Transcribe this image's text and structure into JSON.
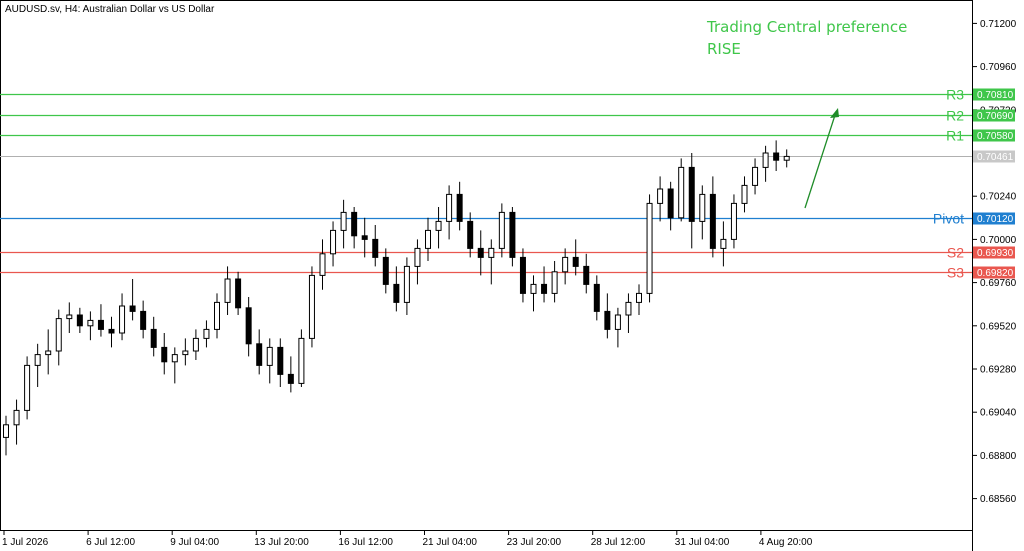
{
  "symbol_title": "AUDUSD.sv, H4:  Australian Dollar vs US Dollar",
  "preference": {
    "line1": "Trading Central preference",
    "line2": "RISE"
  },
  "colors": {
    "resistance": "#3fc64a",
    "support": "#e9574f",
    "pivot": "#1f7fd0",
    "arrow": "#1e8c28",
    "current": "#b0b0b0",
    "candle": "#000000"
  },
  "price_axis": {
    "ticks": [
      "0.71200",
      "0.70960",
      "0.70720",
      "0.70240",
      "0.70000",
      "0.69760",
      "0.69520",
      "0.69280",
      "0.69040",
      "0.68800",
      "0.68560"
    ]
  },
  "time_axis": {
    "ticks": [
      "1 Jul 2026",
      "6 Jul 12:00",
      "9 Jul 04:00",
      "13 Jul 20:00",
      "16 Jul 12:00",
      "21 Jul 04:00",
      "23 Jul 20:00",
      "28 Jul 12:00",
      "31 Jul 04:00",
      "4 Aug 20:00"
    ]
  },
  "levels": [
    {
      "name": "R3",
      "value": 0.7081,
      "label": "0.70810",
      "kind": "resistance"
    },
    {
      "name": "R2",
      "value": 0.7069,
      "label": "0.70690",
      "kind": "resistance"
    },
    {
      "name": "R1",
      "value": 0.7058,
      "label": "0.70580",
      "kind": "resistance"
    },
    {
      "name": "Pivot",
      "value": 0.7012,
      "label": "0.70120",
      "kind": "pivot"
    },
    {
      "name": "S2",
      "value": 0.6993,
      "label": "0.69930",
      "kind": "support"
    },
    {
      "name": "S3",
      "value": 0.6982,
      "label": "0.69820",
      "kind": "support"
    }
  ],
  "current_price": {
    "value": 0.70461,
    "label": "0.70461"
  },
  "chart_data": {
    "type": "candlestick",
    "ohlc": [
      [
        0.689,
        0.6902,
        0.688,
        0.6897
      ],
      [
        0.6897,
        0.6911,
        0.6886,
        0.6905
      ],
      [
        0.6905,
        0.6935,
        0.69,
        0.693
      ],
      [
        0.693,
        0.6942,
        0.6918,
        0.6936
      ],
      [
        0.6936,
        0.695,
        0.6925,
        0.6938
      ],
      [
        0.6938,
        0.6961,
        0.693,
        0.6956
      ],
      [
        0.6956,
        0.6965,
        0.6948,
        0.6958
      ],
      [
        0.6958,
        0.6962,
        0.6948,
        0.6952
      ],
      [
        0.6952,
        0.696,
        0.6944,
        0.6955
      ],
      [
        0.6955,
        0.6964,
        0.6946,
        0.695
      ],
      [
        0.695,
        0.6957,
        0.694,
        0.6948
      ],
      [
        0.6948,
        0.697,
        0.6944,
        0.6963
      ],
      [
        0.6963,
        0.6978,
        0.6955,
        0.696
      ],
      [
        0.696,
        0.6966,
        0.6945,
        0.695
      ],
      [
        0.695,
        0.6957,
        0.6935,
        0.694
      ],
      [
        0.694,
        0.6948,
        0.6925,
        0.6932
      ],
      [
        0.6932,
        0.694,
        0.692,
        0.6936
      ],
      [
        0.6936,
        0.6945,
        0.693,
        0.6938
      ],
      [
        0.6938,
        0.695,
        0.6933,
        0.6945
      ],
      [
        0.6945,
        0.6955,
        0.694,
        0.695
      ],
      [
        0.695,
        0.697,
        0.6945,
        0.6965
      ],
      [
        0.6965,
        0.6985,
        0.6958,
        0.6978
      ],
      [
        0.6978,
        0.6982,
        0.6958,
        0.6962
      ],
      [
        0.6962,
        0.6968,
        0.6935,
        0.6942
      ],
      [
        0.6942,
        0.695,
        0.6925,
        0.693
      ],
      [
        0.693,
        0.6945,
        0.692,
        0.694
      ],
      [
        0.694,
        0.6945,
        0.6918,
        0.6925
      ],
      [
        0.6925,
        0.6935,
        0.6915,
        0.692
      ],
      [
        0.692,
        0.695,
        0.6918,
        0.6945
      ],
      [
        0.6945,
        0.6985,
        0.694,
        0.698
      ],
      [
        0.698,
        0.7,
        0.6972,
        0.6992
      ],
      [
        0.6992,
        0.701,
        0.6985,
        0.7005
      ],
      [
        0.7005,
        0.7022,
        0.6995,
        0.7015
      ],
      [
        0.7015,
        0.7018,
        0.6995,
        0.7002
      ],
      [
        0.7002,
        0.7012,
        0.699,
        0.7
      ],
      [
        0.7,
        0.7008,
        0.6985,
        0.699
      ],
      [
        0.699,
        0.6995,
        0.697,
        0.6975
      ],
      [
        0.6975,
        0.6985,
        0.696,
        0.6965
      ],
      [
        0.6965,
        0.699,
        0.6958,
        0.6985
      ],
      [
        0.6985,
        0.7,
        0.6975,
        0.6995
      ],
      [
        0.6995,
        0.7012,
        0.6988,
        0.7005
      ],
      [
        0.7005,
        0.7018,
        0.6995,
        0.701
      ],
      [
        0.701,
        0.703,
        0.7,
        0.7025
      ],
      [
        0.7025,
        0.7032,
        0.7005,
        0.701
      ],
      [
        0.701,
        0.7015,
        0.699,
        0.6995
      ],
      [
        0.6995,
        0.7005,
        0.698,
        0.699
      ],
      [
        0.699,
        0.7,
        0.6975,
        0.6995
      ],
      [
        0.6995,
        0.702,
        0.699,
        0.7015
      ],
      [
        0.7015,
        0.7018,
        0.6985,
        0.699
      ],
      [
        0.699,
        0.6995,
        0.6965,
        0.697
      ],
      [
        0.697,
        0.698,
        0.696,
        0.6975
      ],
      [
        0.6975,
        0.6985,
        0.6965,
        0.697
      ],
      [
        0.697,
        0.6988,
        0.6965,
        0.6982
      ],
      [
        0.6982,
        0.6995,
        0.6975,
        0.699
      ],
      [
        0.699,
        0.7,
        0.698,
        0.6985
      ],
      [
        0.6985,
        0.6992,
        0.697,
        0.6975
      ],
      [
        0.6975,
        0.698,
        0.6955,
        0.696
      ],
      [
        0.696,
        0.697,
        0.6945,
        0.695
      ],
      [
        0.695,
        0.6962,
        0.694,
        0.6958
      ],
      [
        0.6958,
        0.697,
        0.6948,
        0.6965
      ],
      [
        0.6965,
        0.6975,
        0.6958,
        0.697
      ],
      [
        0.697,
        0.7025,
        0.6965,
        0.702
      ],
      [
        0.702,
        0.7035,
        0.701,
        0.7028
      ],
      [
        0.7028,
        0.7032,
        0.7005,
        0.7012
      ],
      [
        0.7012,
        0.7045,
        0.701,
        0.704
      ],
      [
        0.704,
        0.7048,
        0.6995,
        0.701
      ],
      [
        0.701,
        0.703,
        0.7,
        0.7025
      ],
      [
        0.7025,
        0.7035,
        0.699,
        0.6995
      ],
      [
        0.6995,
        0.701,
        0.6985,
        0.7
      ],
      [
        0.7,
        0.7025,
        0.6995,
        0.702
      ],
      [
        0.702,
        0.7035,
        0.7015,
        0.703
      ],
      [
        0.703,
        0.7045,
        0.7025,
        0.704
      ],
      [
        0.704,
        0.7052,
        0.7032,
        0.7048
      ],
      [
        0.7048,
        0.7055,
        0.7038,
        0.7044
      ],
      [
        0.7044,
        0.705,
        0.704,
        0.70461
      ]
    ],
    "ylim": [
      0.6838,
      0.7133
    ],
    "xlabel": "",
    "ylabel": ""
  }
}
